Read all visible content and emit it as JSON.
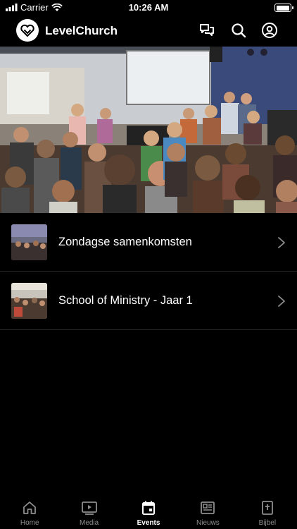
{
  "status_bar": {
    "carrier": "Carrier",
    "time": "10:26 AM"
  },
  "header": {
    "app_title": "LevelChurch"
  },
  "events": [
    {
      "title": "Zondagse samenkomsten"
    },
    {
      "title": "School of Ministry - Jaar 1"
    }
  ],
  "tabs": [
    {
      "label": "Home",
      "icon": "home-icon",
      "active": false
    },
    {
      "label": "Media",
      "icon": "media-icon",
      "active": false
    },
    {
      "label": "Events",
      "icon": "calendar-icon",
      "active": true
    },
    {
      "label": "Nieuws",
      "icon": "news-icon",
      "active": false
    },
    {
      "label": "Bijbel",
      "icon": "bible-icon",
      "active": false
    }
  ],
  "colors": {
    "background": "#000000",
    "text": "#ffffff",
    "inactive": "#8e8e8e",
    "divider": "#2a2a2a"
  }
}
